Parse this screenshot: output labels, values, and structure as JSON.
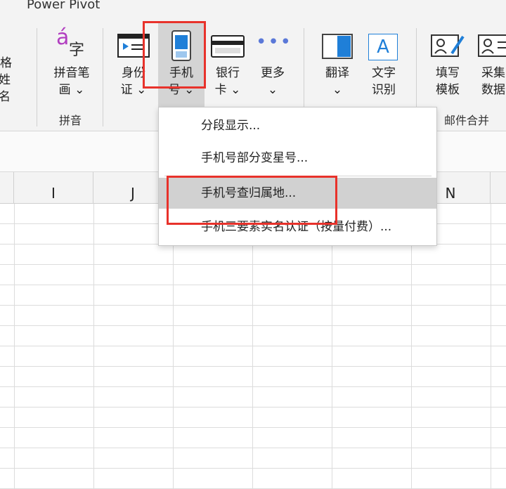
{
  "ribbon": {
    "tab_title": "Power Pivot",
    "left_partial": {
      "line1": "格",
      "line2": "姓名"
    },
    "pinyin": {
      "label": "拼音笔\n画 ⌄",
      "group": "拼音"
    },
    "idcard": {
      "label": "身份\n证 ⌄"
    },
    "phone": {
      "label": "手机\n号 ⌄"
    },
    "bankcard": {
      "label": "银行\n卡 ⌄"
    },
    "more": {
      "label": "更多\n⌄"
    },
    "translate": {
      "label": "翻译\n⌄"
    },
    "ocr": {
      "label": "文字\n识别"
    },
    "fill_template": {
      "label": "填写\n模板"
    },
    "collect_data": {
      "label": "采集\n数据"
    },
    "mail_group": "邮件合并",
    "icon_glyphs": {
      "pinyin_a": "á",
      "pinyin_zi": "字",
      "ocr_a": "A",
      "more_dots": "•••"
    }
  },
  "columns": [
    "I",
    "J",
    "N"
  ],
  "dropdown": {
    "items": [
      "分段显示...",
      "手机号部分变星号...",
      "手机号查归属地...",
      "手机三要素实名认证（按量付费）..."
    ]
  },
  "colors": {
    "highlight_box": "#e8322b",
    "menu_hover": "#d1d1d1",
    "accent_blue": "#1f7fd8"
  }
}
